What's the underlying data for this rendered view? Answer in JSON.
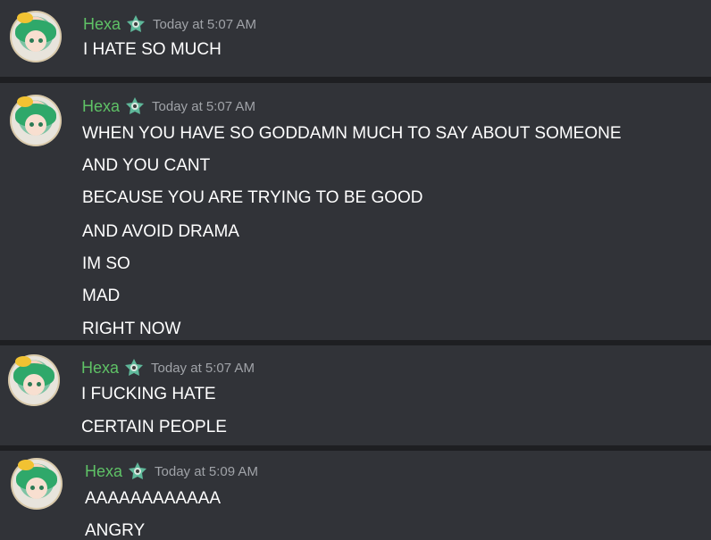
{
  "messages": [
    {
      "username": "Hexa",
      "timestamp": "Today at 5:07 AM",
      "lines": [
        "I HATE SO MUCH"
      ]
    },
    {
      "username": "Hexa",
      "timestamp": "Today at 5:07 AM",
      "lines": [
        "WHEN YOU HAVE SO GODDAMN MUCH TO SAY ABOUT SOMEONE",
        "AND YOU CANT",
        "BECAUSE YOU ARE TRYING TO BE GOOD",
        "AND AVOID DRAMA",
        "IM SO",
        "MAD",
        "RIGHT NOW"
      ]
    },
    {
      "username": "Hexa",
      "timestamp": "Today at 5:07 AM",
      "lines": [
        "I FUCKING HATE",
        "CERTAIN PEOPLE"
      ]
    },
    {
      "username": "Hexa",
      "timestamp": "Today at 5:09 AM",
      "lines": [
        "AAAAAAAAAAAA",
        "ANGRY"
      ]
    }
  ],
  "colors": {
    "background": "#313338",
    "separator": "#1e1f22",
    "username": "#5fc266",
    "timestamp": "#a0a3a8",
    "text": "#ffffff"
  },
  "icons": {
    "avatar": "avatar-image",
    "badge": "role-badge-icon"
  }
}
